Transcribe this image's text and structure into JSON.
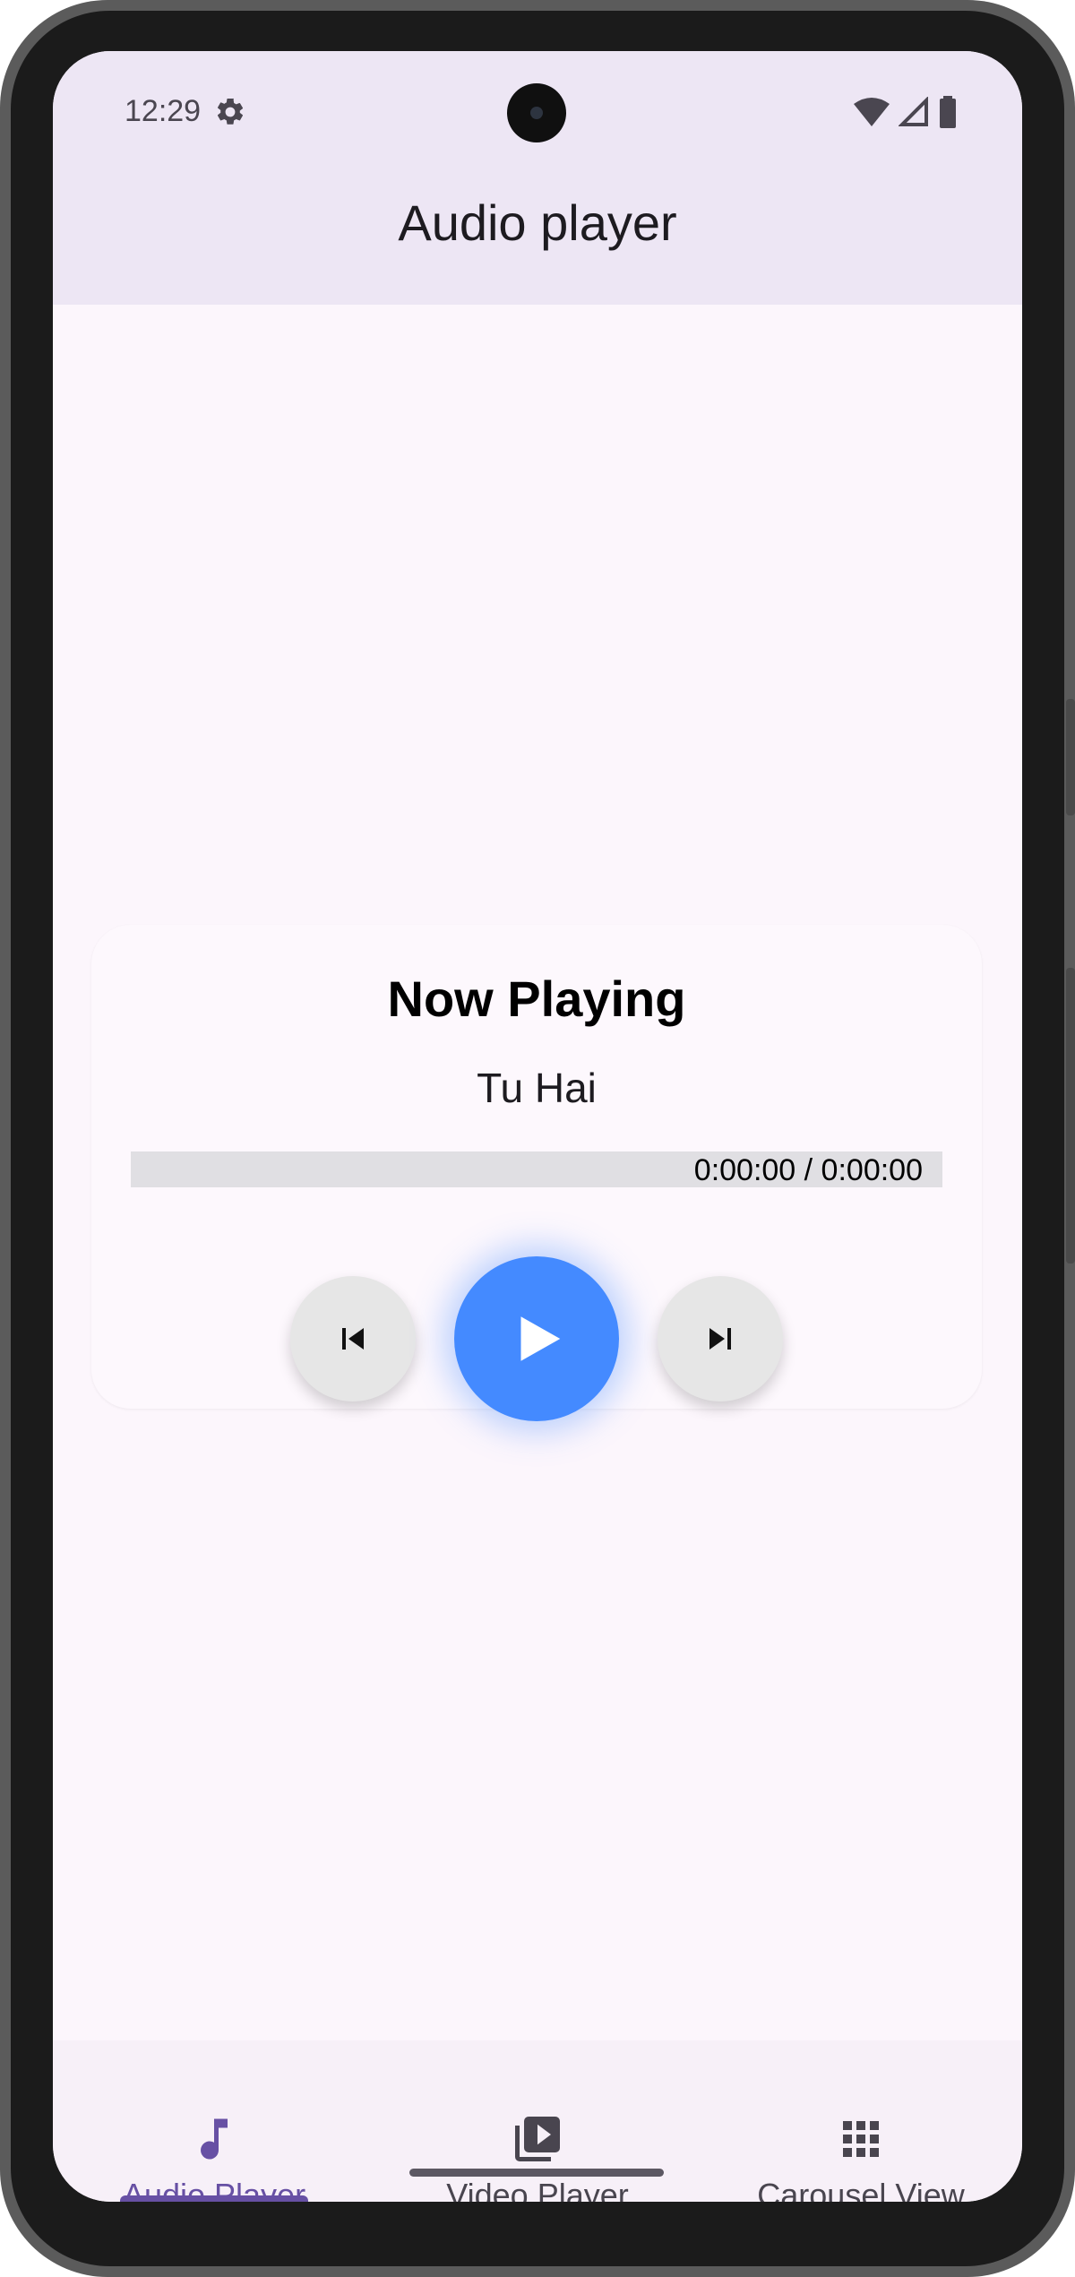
{
  "status_bar": {
    "time": "12:29",
    "icons": [
      "settings-gear-icon",
      "wifi-icon",
      "cell-signal-icon",
      "battery-icon"
    ]
  },
  "app_bar": {
    "title": "Audio player"
  },
  "player": {
    "heading": "Now Playing",
    "track": "Tu Hai",
    "time_display": "0:00:00 / 0:00:00",
    "progress": 0,
    "controls": {
      "previous_icon": "skip-previous-icon",
      "play_icon": "play-icon",
      "next_icon": "skip-next-icon"
    }
  },
  "bottom_nav": {
    "items": [
      {
        "label": "Audio Player",
        "icon": "music-note-icon",
        "selected": true
      },
      {
        "label": "Video Player",
        "icon": "video-library-icon",
        "selected": false
      },
      {
        "label": "Carousel View",
        "icon": "grid-apps-icon",
        "selected": false
      }
    ]
  },
  "colors": {
    "accent": "#6750a4",
    "play_button": "#448aff",
    "app_bar": "#ede6f4",
    "background": "#fcf6fc"
  }
}
